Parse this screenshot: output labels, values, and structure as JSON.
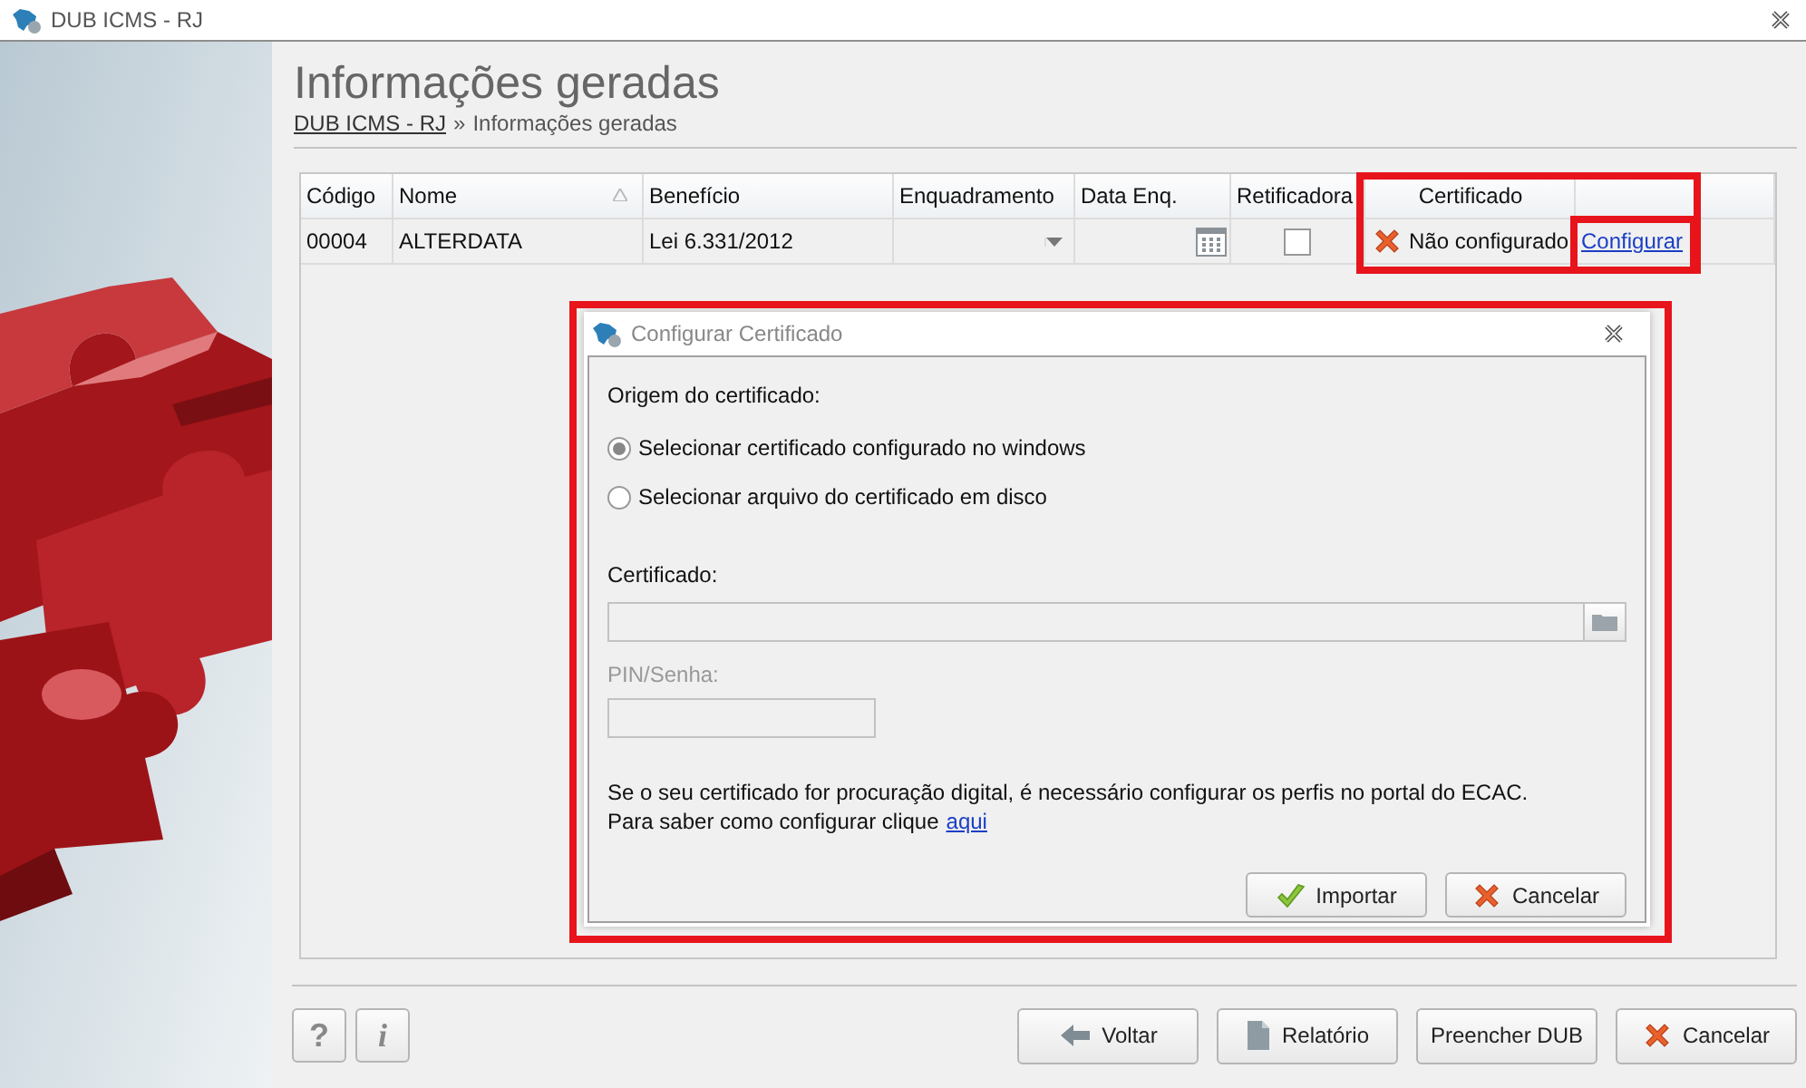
{
  "window": {
    "title": "DUB ICMS - RJ"
  },
  "page": {
    "title": "Informações geradas",
    "breadcrumb": {
      "link": "DUB ICMS - RJ",
      "separator": "»",
      "current": "Informações geradas"
    }
  },
  "table": {
    "columns": [
      {
        "label": "Código",
        "sorted": false
      },
      {
        "label": "Nome",
        "sorted": true
      },
      {
        "label": "Benefício",
        "sorted": false
      },
      {
        "label": "Enquadramento",
        "sorted": false
      },
      {
        "label": "Data Enq.",
        "sorted": false
      },
      {
        "label": "Retificadora",
        "sorted": false
      },
      {
        "label": "Certificado",
        "sorted": false
      }
    ],
    "rows": [
      {
        "codigo": "00004",
        "nome": "ALTERDATA",
        "beneficio": "Lei 6.331/2012",
        "retificadora": {
          "checked": false
        },
        "certificado": {
          "configured": false,
          "status": "Não configurado"
        },
        "action": "Configurar"
      }
    ]
  },
  "dialog": {
    "title": "Configurar Certificado",
    "origin_label": "Origem do certificado:",
    "options": [
      {
        "label": "Selecionar certificado configurado no windows",
        "selected": true
      },
      {
        "label": "Selecionar arquivo do certificado em disco",
        "selected": false
      }
    ],
    "certificate_field": {
      "label": "Certificado:"
    },
    "pin_field": {
      "label": "PIN/Senha:",
      "disabled": true
    },
    "note": "Se o seu certificado for procuração digital, é necessário configurar os perfis no portal do ECAC.",
    "help": {
      "text": "Para saber como configurar clique",
      "link": "aqui"
    },
    "buttons": [
      {
        "label": "Importar",
        "kind": "ok"
      },
      {
        "label": "Cancelar",
        "kind": "cancel"
      }
    ]
  },
  "footer": {
    "tools": [
      {
        "label": "?"
      },
      {
        "label": "i"
      }
    ],
    "buttons": [
      {
        "label": "Voltar",
        "kind": "back"
      },
      {
        "label": "Relatório",
        "kind": "report"
      },
      {
        "label": "Preencher DUB",
        "kind": "plain"
      },
      {
        "label": "Cancelar",
        "kind": "cancel"
      }
    ]
  }
}
